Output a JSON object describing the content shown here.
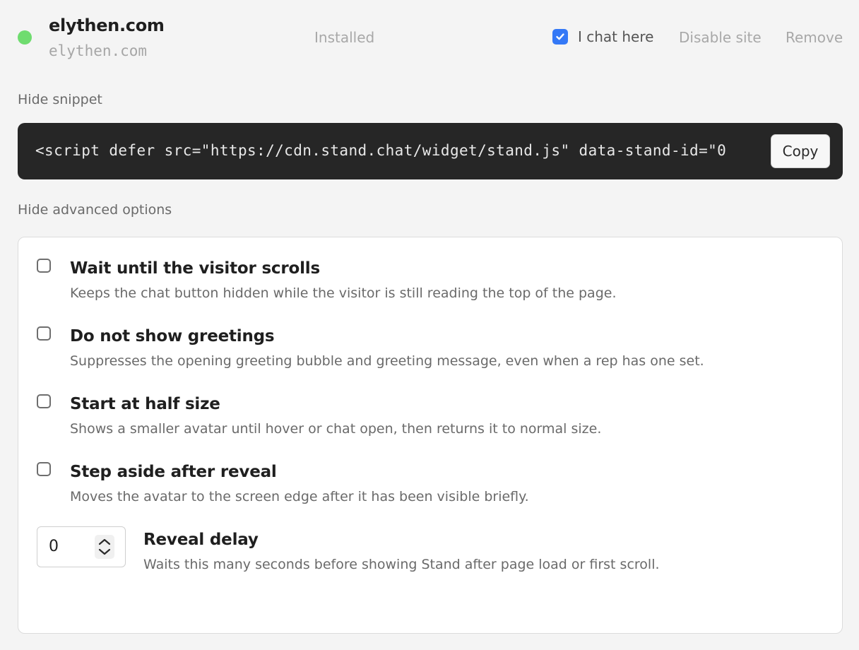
{
  "site": {
    "name": "elythen.com",
    "domain": "elythen.com",
    "status": "Installed",
    "status_color": "#6fdc6f",
    "chat_here_label": "I chat here",
    "chat_here_checked": true,
    "disable_label": "Disable site",
    "remove_label": "Remove"
  },
  "snippet": {
    "toggle_label": "Hide snippet",
    "code": "<script defer src=\"https://cdn.stand.chat/widget/stand.js\" data-stand-id=\"0",
    "copy_label": "Copy"
  },
  "advanced": {
    "toggle_label": "Hide advanced options",
    "options": [
      {
        "title": "Wait until the visitor scrolls",
        "description": "Keeps the chat button hidden while the visitor is still reading the top of the page.",
        "checked": false
      },
      {
        "title": "Do not show greetings",
        "description": "Suppresses the opening greeting bubble and greeting message, even when a rep has one set.",
        "checked": false
      },
      {
        "title": "Start at half size",
        "description": "Shows a smaller avatar until hover or chat open, then returns it to normal size.",
        "checked": false
      },
      {
        "title": "Step aside after reveal",
        "description": "Moves the avatar to the screen edge after it has been visible briefly.",
        "checked": false
      }
    ],
    "reveal_delay": {
      "value": "0",
      "title": "Reveal delay",
      "description": "Waits this many seconds before showing Stand after page load or first scroll."
    }
  },
  "colors": {
    "accent": "#3478f6",
    "snippet_bg": "#262626"
  }
}
